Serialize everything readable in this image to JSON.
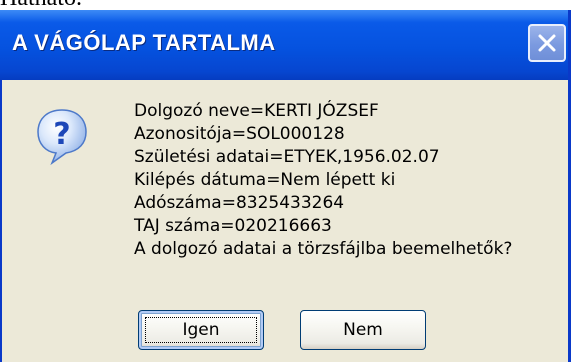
{
  "background_text": "Hatható.",
  "dialog": {
    "title": "A VÁGÓLAP TARTALMA",
    "icon": "question-icon",
    "message_lines": [
      "Dolgozó neve=KERTI JÓZSEF",
      "Azonositója=SOL000128",
      "Születési adatai=ETYEK,1956.02.07",
      "Kilépés dátuma=Nem lépett ki",
      "Adószáma=8325433264",
      "TAJ száma=020216663",
      "A dolgozó adatai a törzsfájlba beemelhetők?"
    ],
    "buttons": {
      "yes_label": "Igen",
      "no_label": "Nem"
    }
  },
  "colors": {
    "titlebar": "#0552df",
    "dialog_bg": "#ece9d8",
    "close_button": "#7b9ae0",
    "button_border": "#003c74"
  }
}
